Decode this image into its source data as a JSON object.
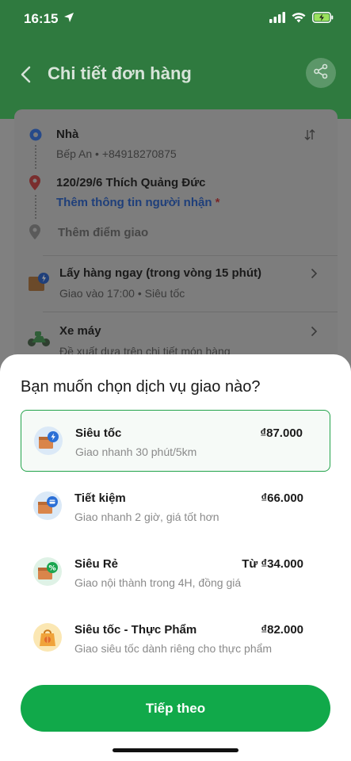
{
  "status": {
    "time": "16:15"
  },
  "header": {
    "title": "Chi tiết đơn hàng"
  },
  "route": {
    "pickup": {
      "label": "Nhà",
      "detail": "Bếp An • +84918270875"
    },
    "dropoff": {
      "label": "120/29/6 Thích Quảng Đức",
      "add_recipient": "Thêm thông tin người nhận",
      "required_mark": "*"
    },
    "add_stop": "Thêm điểm giao"
  },
  "delivery_time": {
    "title": "Lấy hàng ngay (trong vòng 15 phút)",
    "subtitle": "Giao vào 17:00 • Siêu tốc"
  },
  "vehicle": {
    "title": "Xe máy",
    "subtitle": "Đề xuất dựa trên chi tiết món hàng"
  },
  "sheet": {
    "title": "Bạn muốn chọn dịch vụ giao nào?",
    "options": [
      {
        "name": "Siêu tốc",
        "desc": "Giao nhanh 30 phút/5km",
        "price": "₫87.000",
        "icon": "express-box-icon",
        "selected": true
      },
      {
        "name": "Tiết kiệm",
        "desc": "Giao nhanh 2 giờ, giá tốt hơn",
        "price": "₫66.000",
        "icon": "saver-box-icon",
        "selected": false
      },
      {
        "name": "Siêu Rẻ",
        "desc": "Giao nội thành trong 4H, đồng giá",
        "price": "Từ ₫34.000",
        "icon": "discount-box-icon",
        "selected": false
      },
      {
        "name": "Siêu tốc - Thực Phẩm",
        "desc": "Giao siêu tốc dành riêng cho thực phẩm",
        "price": "₫82.000",
        "icon": "food-bag-icon",
        "selected": false
      }
    ],
    "cta_label": "Tiếp theo"
  },
  "colors": {
    "primary_green": "#11a94a",
    "selected_border": "#22a34a"
  }
}
